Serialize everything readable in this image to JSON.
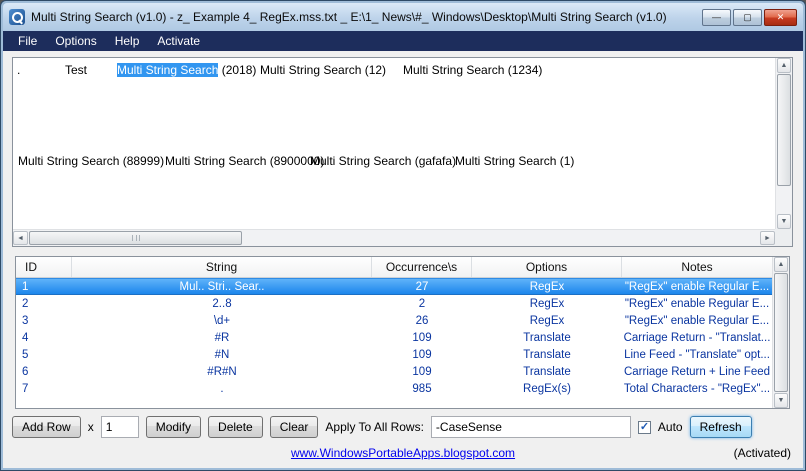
{
  "window": {
    "title": "Multi String Search (v1.0) - z_ Example 4_ RegEx.mss.txt _ E:\\1_ News\\#_ Windows\\Desktop\\Multi String Search (v1.0)"
  },
  "icons": {
    "minimize": "—",
    "maximize": "▢",
    "close": "✕",
    "scroll_up": "▲",
    "scroll_down": "▼",
    "scroll_left": "◄",
    "scroll_right": "►",
    "check": "✓"
  },
  "colors": {
    "selection_blue": "#3296f0",
    "menubar_navy": "#1d2d5c",
    "row_selected_blue": "#1c86ec",
    "link_blue": "#0000ee",
    "grid_text_navy": "#0a35a0"
  },
  "menu": {
    "file": "File",
    "options": "Options",
    "help": "Help",
    "activate": "Activate"
  },
  "editor": {
    "line1": {
      "dot": ".",
      "test": "Test",
      "selected": "Multi String Search",
      "selected_suffix": " (2018)",
      "token3": "Multi String Search (12)",
      "token4": "Multi String Search (1234)"
    },
    "line2": {
      "token1": "Multi String Search (88999)",
      "token2": "Multi String Search (8900000)",
      "token3": "Multi String Search (gafafa)",
      "token4": "Multi String Search (1)"
    }
  },
  "table": {
    "headers": {
      "id": "ID",
      "string": "String",
      "occurrences": "Occurrence\\s",
      "options": "Options",
      "notes": "Notes"
    },
    "rows": [
      {
        "id": "1",
        "string": "Mul.. Stri.. Sear..",
        "occ": "27",
        "opt": "RegEx",
        "notes": "\"RegEx\" enable Regular E..."
      },
      {
        "id": "2",
        "string": "2..8",
        "occ": "2",
        "opt": "RegEx",
        "notes": "\"RegEx\" enable Regular E..."
      },
      {
        "id": "3",
        "string": "\\d+",
        "occ": "26",
        "opt": "RegEx",
        "notes": "\"RegEx\" enable Regular E..."
      },
      {
        "id": "4",
        "string": "#R",
        "occ": "109",
        "opt": "Translate",
        "notes": "Carriage Return - \"Translat..."
      },
      {
        "id": "5",
        "string": "#N",
        "occ": "109",
        "opt": "Translate",
        "notes": "Line Feed - \"Translate\" opt..."
      },
      {
        "id": "6",
        "string": "#R#N",
        "occ": "109",
        "opt": "Translate",
        "notes": "Carriage Return + Line Feed"
      },
      {
        "id": "7",
        "string": ".",
        "occ": "985",
        "opt": "RegEx(s)",
        "notes": "Total Characters - \"RegEx\"..."
      }
    ]
  },
  "controls": {
    "add_row": "Add Row",
    "x_label": "x",
    "count": "1",
    "modify": "Modify",
    "delete": "Delete",
    "clear": "Clear",
    "apply_label": "Apply To All Rows:",
    "apply_value": "-CaseSense",
    "auto_label": "Auto",
    "refresh": "Refresh"
  },
  "footer": {
    "link": "www.WindowsPortableApps.blogspot.com",
    "activated": "(Activated)"
  }
}
